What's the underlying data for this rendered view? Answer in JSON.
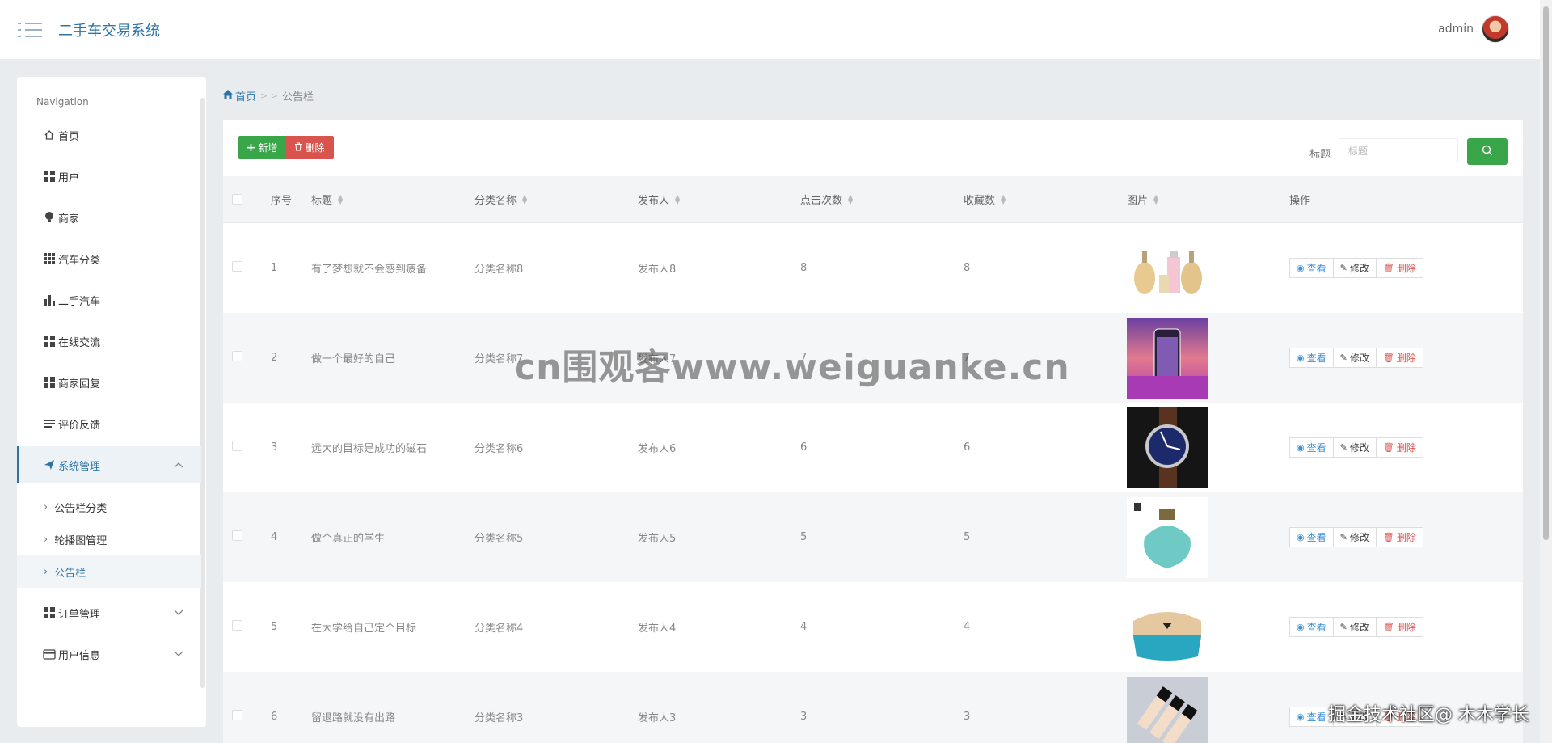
{
  "app": {
    "title": "二手车交易系统",
    "user": "admin"
  },
  "sidebar": {
    "caption": "Navigation",
    "items": [
      {
        "label": "首页",
        "icon": "home-icon"
      },
      {
        "label": "用户",
        "icon": "grid-icon"
      },
      {
        "label": "商家",
        "icon": "lightbulb-icon"
      },
      {
        "label": "汽车分类",
        "icon": "grid9-icon"
      },
      {
        "label": "二手汽车",
        "icon": "bar-chart-icon"
      },
      {
        "label": "在线交流",
        "icon": "grid-icon"
      },
      {
        "label": "商家回复",
        "icon": "grid-icon"
      },
      {
        "label": "评价反馈",
        "icon": "list-icon"
      },
      {
        "label": "系统管理",
        "icon": "paper-plane-icon",
        "expanded": true
      },
      {
        "label": "订单管理",
        "icon": "grid-icon"
      },
      {
        "label": "用户信息",
        "icon": "card-icon"
      }
    ],
    "sub_items": [
      {
        "label": "公告栏分类"
      },
      {
        "label": "轮播图管理"
      },
      {
        "label": "公告栏",
        "active": true
      }
    ]
  },
  "breadcrumb": {
    "home": "首页",
    "sep": "> >",
    "current": "公告栏"
  },
  "toolbar": {
    "add_label": "新增",
    "delete_label": "删除",
    "search_label": "标题",
    "search_placeholder": "标题"
  },
  "table": {
    "headers": {
      "idx": "序号",
      "title": "标题",
      "category": "分类名称",
      "publisher": "发布人",
      "clicks": "点击次数",
      "favorites": "收藏数",
      "image": "图片",
      "ops": "操作"
    },
    "op_labels": {
      "view": "查看",
      "edit": "修改",
      "delete": "删除"
    },
    "rows": [
      {
        "idx": "1",
        "title": "有了梦想就不会感到疲备",
        "category": "分类名称8",
        "publisher": "发布人8",
        "clicks": "8",
        "favorites": "8",
        "image": "perfume-bottles"
      },
      {
        "idx": "2",
        "title": "做一个最好的自己",
        "category": "分类名称7",
        "publisher": "发布人7",
        "clicks": "7",
        "favorites": "7",
        "image": "phone-case"
      },
      {
        "idx": "3",
        "title": "远大的目标是成功的磁石",
        "category": "分类名称6",
        "publisher": "发布人6",
        "clicks": "6",
        "favorites": "6",
        "image": "wrist-watch"
      },
      {
        "idx": "4",
        "title": "做个真正的学生",
        "category": "分类名称5",
        "publisher": "发布人5",
        "clicks": "5",
        "favorites": "5",
        "image": "perfume-teal"
      },
      {
        "idx": "5",
        "title": "在大学给自己定个目标",
        "category": "分类名称4",
        "publisher": "发布人4",
        "clicks": "4",
        "favorites": "4",
        "image": "handbag"
      },
      {
        "idx": "6",
        "title": "留退路就没有出路",
        "category": "分类名称3",
        "publisher": "发布人3",
        "clicks": "3",
        "favorites": "3",
        "image": "cosmetics"
      }
    ]
  },
  "watermarks": {
    "center": "cn围观客www.weiguanke.cn",
    "corner": "掘金技术社区@ 木木学长"
  }
}
